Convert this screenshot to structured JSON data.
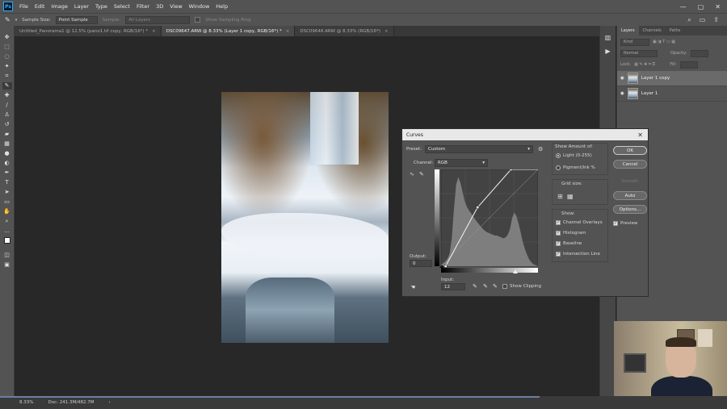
{
  "menubar": {
    "logo": "Ps",
    "items": [
      "File",
      "Edit",
      "Image",
      "Layer",
      "Type",
      "Select",
      "Filter",
      "3D",
      "View",
      "Window",
      "Help"
    ],
    "controls": [
      "—",
      "▢",
      "✕"
    ]
  },
  "options": {
    "sample_size_label": "Sample Size:",
    "sample_size_value": "Point Sample",
    "sample_label": "Sample:",
    "sample_value": "All Layers",
    "show_ring_label": "Show Sampling Ring"
  },
  "tabs": [
    {
      "label": "Untitled_Panorama1 @ 12.5% (pano1.tif copy, RGB/16*) *",
      "active": false
    },
    {
      "label": "DSC09647.ARW @ 8.33% (Layer 1 copy, RGB/16*) *",
      "active": true
    },
    {
      "label": "DSC09648.ARW @ 8.33% (RGB/16*)",
      "active": false
    }
  ],
  "layers_panel": {
    "tabs": [
      "Layers",
      "Channels",
      "Paths"
    ],
    "kind_placeholder": "Kind",
    "blend_mode": "Normal",
    "opacity_label": "Opacity:",
    "lock_label": "Lock:",
    "fill_label": "Fill:",
    "layers": [
      {
        "name": "Layer 1 copy",
        "active": true
      },
      {
        "name": "Layer 1",
        "active": false
      }
    ]
  },
  "status": {
    "zoom": "8.33%",
    "doc": "Doc: 241.3M/482.7M"
  },
  "curves": {
    "title": "Curves",
    "preset_label": "Preset:",
    "preset_value": "Custom",
    "channel_label": "Channel:",
    "channel_value": "RGB",
    "output_label": "Output:",
    "output_value": "0",
    "input_label": "Input:",
    "input_value": "12",
    "show_clipping_label": "Show Clipping",
    "show_amount_label": "Show Amount of:",
    "light_label": "Light  (0-255)",
    "pigment_label": "Pigment/Ink %",
    "grid_size_label": "Grid size:",
    "show_label": "Show:",
    "channel_overlays_label": "Channel Overlays",
    "histogram_label": "Histogram",
    "baseline_label": "Baseline",
    "intersection_label": "Intersection Line",
    "buttons": {
      "ok": "OK",
      "cancel": "Cancel",
      "smooth": "Smooth",
      "auto": "Auto",
      "options": "Options..."
    },
    "preview_label": "Preview",
    "curve_points": [
      [
        12,
        0
      ],
      [
        96,
        155
      ],
      [
        184,
        255
      ],
      [
        255,
        255
      ]
    ],
    "histogram": [
      2,
      3,
      5,
      8,
      14,
      30,
      62,
      88,
      96,
      90,
      80,
      70,
      64,
      60,
      57,
      53,
      50,
      47,
      44,
      41,
      39,
      37,
      36,
      35,
      34,
      33,
      33,
      32,
      31,
      30,
      31,
      34,
      40,
      52,
      58,
      54,
      46,
      36,
      26,
      18,
      12,
      7,
      4,
      2,
      1,
      0
    ]
  }
}
